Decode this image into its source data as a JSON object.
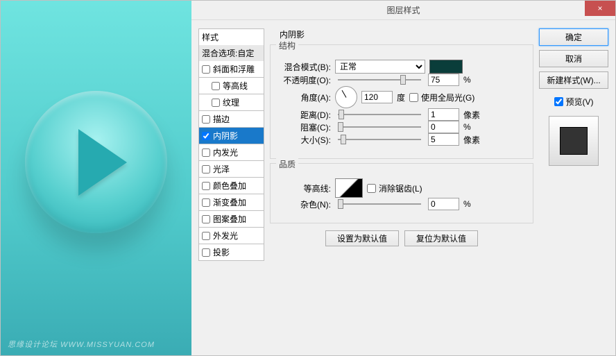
{
  "watermark": "思缘设计论坛  WWW.MISSYUAN.COM",
  "dialog": {
    "title": "图层样式",
    "close": "×",
    "styles_header": "样式",
    "blend_options": "混合选项:自定",
    "style_items": [
      {
        "label": "斜面和浮雕",
        "checked": false,
        "selected": false,
        "indented": false
      },
      {
        "label": "等高线",
        "checked": false,
        "selected": false,
        "indented": true
      },
      {
        "label": "纹理",
        "checked": false,
        "selected": false,
        "indented": true
      },
      {
        "label": "描边",
        "checked": false,
        "selected": false,
        "indented": false
      },
      {
        "label": "内阴影",
        "checked": true,
        "selected": true,
        "indented": false
      },
      {
        "label": "内发光",
        "checked": false,
        "selected": false,
        "indented": false
      },
      {
        "label": "光泽",
        "checked": false,
        "selected": false,
        "indented": false
      },
      {
        "label": "颜色叠加",
        "checked": false,
        "selected": false,
        "indented": false
      },
      {
        "label": "渐变叠加",
        "checked": false,
        "selected": false,
        "indented": false
      },
      {
        "label": "图案叠加",
        "checked": false,
        "selected": false,
        "indented": false
      },
      {
        "label": "外发光",
        "checked": false,
        "selected": false,
        "indented": false
      },
      {
        "label": "投影",
        "checked": false,
        "selected": false,
        "indented": false
      }
    ],
    "panel_title": "内阴影",
    "structure": {
      "legend": "结构",
      "blend_mode_label": "混合模式(B):",
      "blend_mode_value": "正常",
      "opacity_label": "不透明度(O):",
      "opacity_value": "75",
      "opacity_unit": "%",
      "angle_label": "角度(A):",
      "angle_value": "120",
      "angle_unit": "度",
      "global_light_label": "使用全局光(G)",
      "global_light_checked": false,
      "distance_label": "距离(D):",
      "distance_value": "1",
      "distance_unit": "像素",
      "choke_label": "阻塞(C):",
      "choke_value": "0",
      "choke_unit": "%",
      "size_label": "大小(S):",
      "size_value": "5",
      "size_unit": "像素"
    },
    "quality": {
      "legend": "品质",
      "contour_label": "等高线:",
      "antialias_label": "消除锯齿(L)",
      "antialias_checked": false,
      "noise_label": "杂色(N):",
      "noise_value": "0",
      "noise_unit": "%"
    },
    "set_default": "设置为默认值",
    "reset_default": "复位为默认值",
    "buttons": {
      "ok": "确定",
      "cancel": "取消",
      "new_style": "新建样式(W)...",
      "preview": "预览(V)",
      "preview_checked": true
    },
    "colors": {
      "shadow_color": "#0a3d3a"
    }
  }
}
